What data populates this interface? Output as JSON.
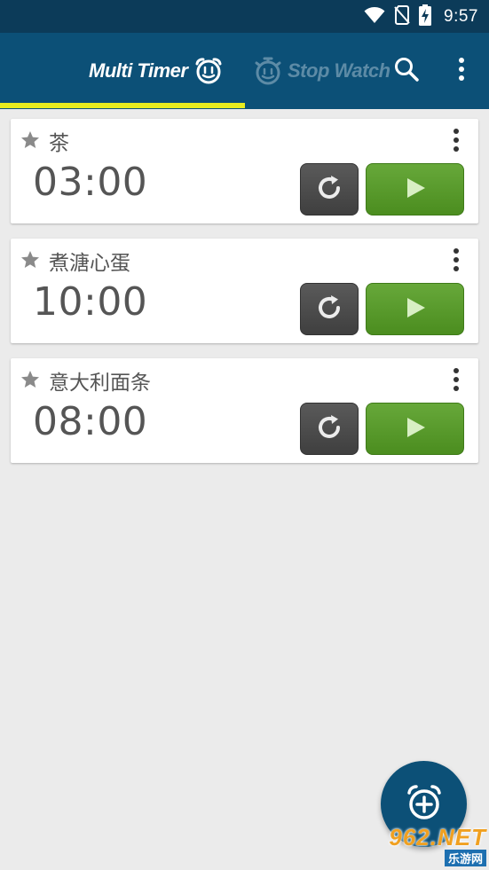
{
  "status_bar": {
    "time": "9:57",
    "icons": [
      "wifi-icon",
      "no-sim-icon",
      "battery-charging-icon"
    ]
  },
  "app_bar": {
    "tabs": [
      {
        "label": "Multi Timer",
        "icon": "alarm-clock-icon",
        "selected": true
      },
      {
        "label": "Stop Watch",
        "icon": "stopwatch-icon",
        "selected": false
      }
    ],
    "actions": [
      "search-icon",
      "overflow-menu-icon"
    ],
    "indicator_color": "#e9ec1f",
    "background": "#0c5077"
  },
  "timers": [
    {
      "name": "茶",
      "time": "03:00"
    },
    {
      "name": "煮溏心蛋",
      "time": "10:00"
    },
    {
      "name": "意大利面条",
      "time": "08:00"
    }
  ],
  "fab": {
    "icon": "add-alarm-icon"
  },
  "watermark": {
    "top": "962.NET",
    "bottom": "乐游网"
  },
  "colors": {
    "play_button": "#5a9b2c",
    "reset_button": "#4a4a4a",
    "card_text": "#555555"
  }
}
